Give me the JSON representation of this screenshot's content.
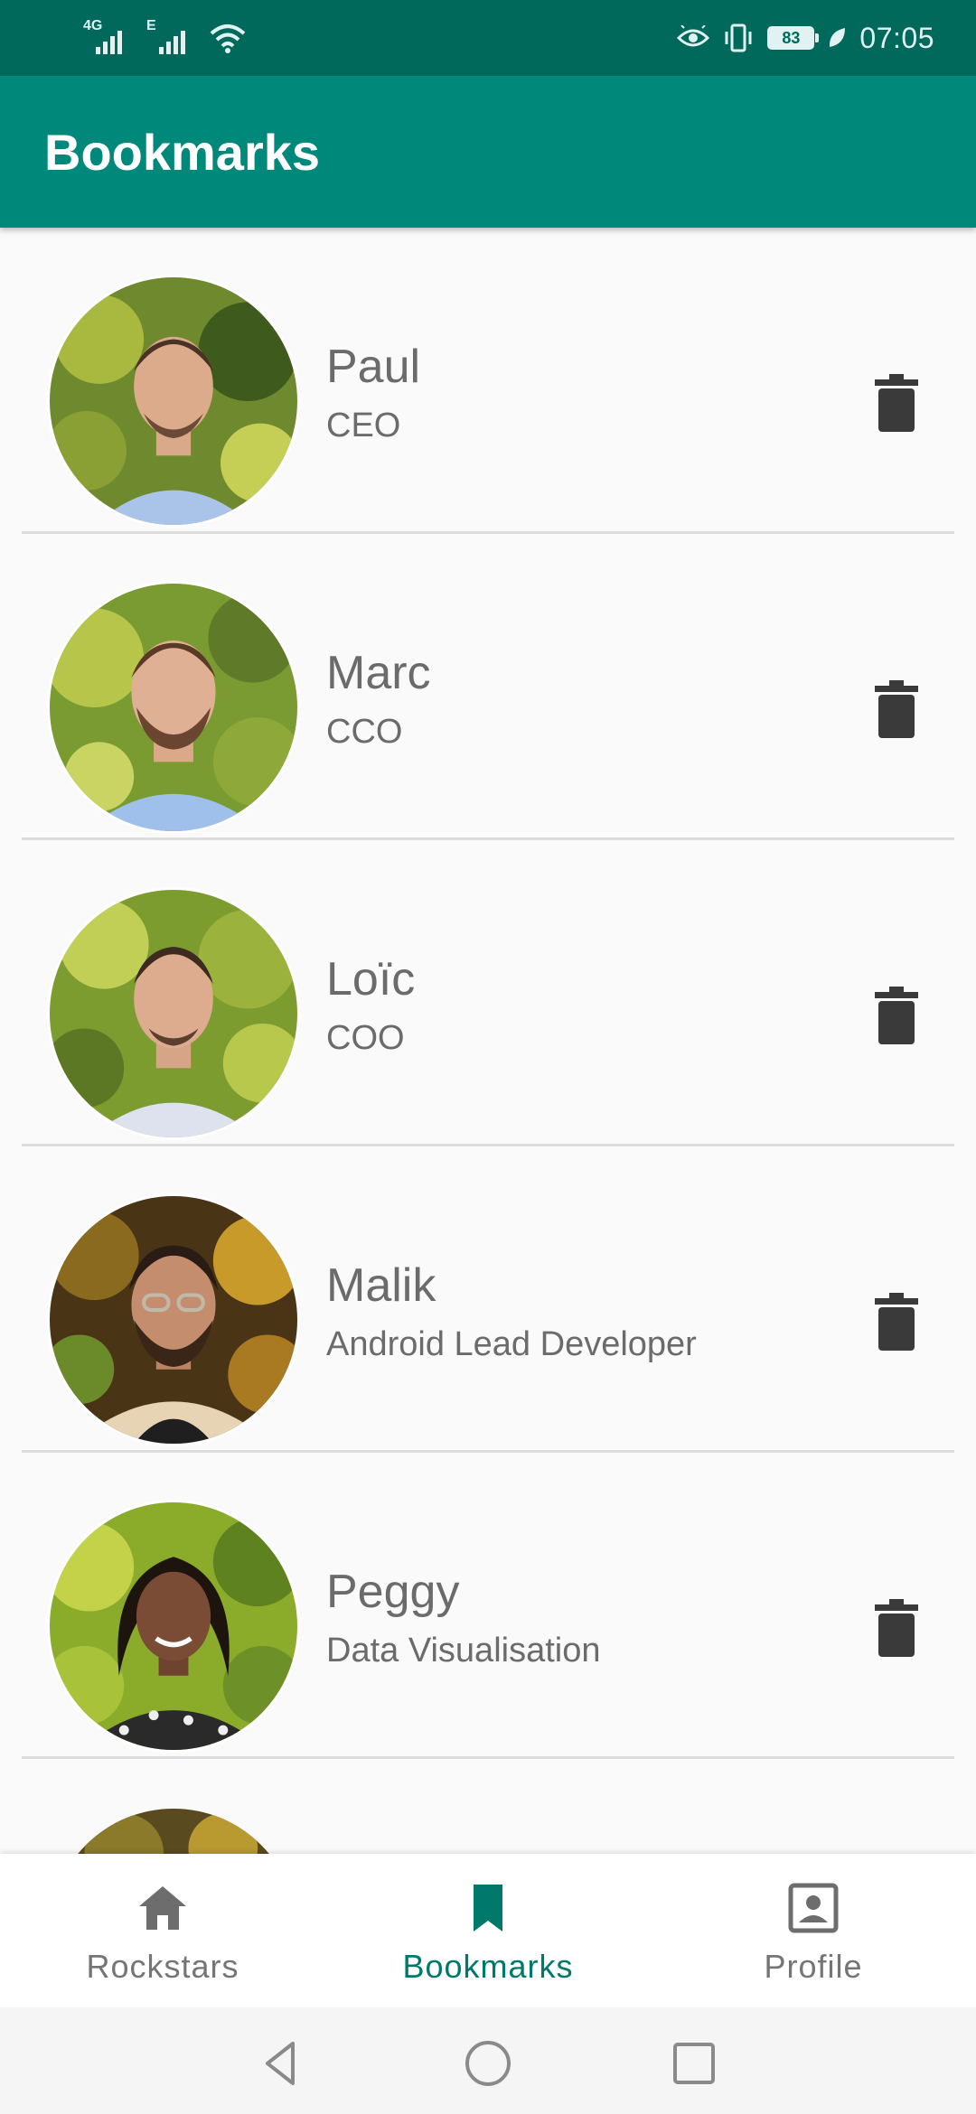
{
  "status_bar": {
    "sim1_label": "4G",
    "sim2_label": "E",
    "battery_level": "83",
    "time": "07:05",
    "icons": [
      "signal-icon",
      "wifi-icon",
      "eye-icon",
      "vibrate-icon",
      "battery-icon",
      "leaf-icon"
    ]
  },
  "app_bar": {
    "title": "Bookmarks"
  },
  "bookmarks": [
    {
      "name": "Paul",
      "role": "CEO"
    },
    {
      "name": "Marc",
      "role": "CCO"
    },
    {
      "name": "Loïc",
      "role": "COO"
    },
    {
      "name": "Malik",
      "role": "Android Lead Developer"
    },
    {
      "name": "Peggy",
      "role": "Data Visualisation"
    }
  ],
  "bottom_nav": {
    "items": [
      {
        "label": "Rockstars",
        "icon": "home-icon",
        "active": false
      },
      {
        "label": "Bookmarks",
        "icon": "bookmark-icon",
        "active": true
      },
      {
        "label": "Profile",
        "icon": "portrait-icon",
        "active": false
      }
    ]
  },
  "colors": {
    "status_bar": "#00695c",
    "app_bar": "#00897b",
    "accent": "#00796b",
    "text_secondary": "#6b6b6b"
  }
}
